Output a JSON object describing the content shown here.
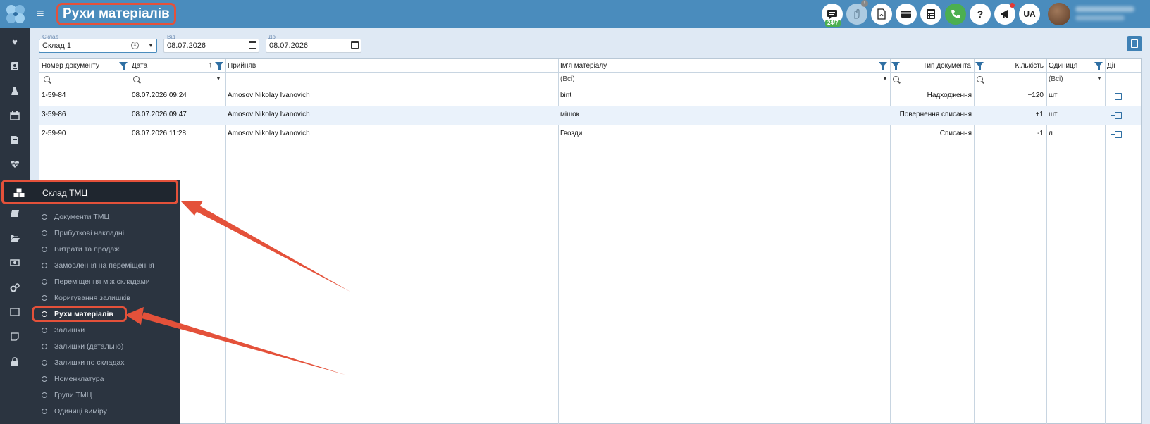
{
  "header": {
    "title": "Рухи матеріалів",
    "support_badge": "24/7",
    "language": "UA",
    "icons": [
      "chat-icon",
      "hand-icon",
      "pdf-icon",
      "card-icon",
      "calculator-icon",
      "phone-icon",
      "help-icon",
      "megaphone-icon"
    ]
  },
  "filters": {
    "warehouse": {
      "label": "Склад",
      "value": "Склад 1"
    },
    "from": {
      "label": "Від",
      "value": "08.07.2026"
    },
    "to": {
      "label": "До",
      "value": "08.07.2026"
    }
  },
  "grid": {
    "columns": [
      "Номер документу",
      "Дата",
      "Прийняв",
      "Ім'я матеріалу",
      "Тип документа",
      "Кількість",
      "Одиниця",
      "Дії"
    ],
    "filter_all": "(Всі)",
    "rows": [
      {
        "doc": "1-59-84",
        "date": "08.07.2026 09:24",
        "accepted": "Amosov Nikolay Ivanovich",
        "material": "bint",
        "type": "Надходження",
        "qty": "+120",
        "unit": "шт"
      },
      {
        "doc": "3-59-86",
        "date": "08.07.2026 09:47",
        "accepted": "Amosov Nikolay Ivanovich",
        "material": "мішок",
        "type": "Повернення списання",
        "qty": "+1",
        "unit": "шт"
      },
      {
        "doc": "2-59-90",
        "date": "08.07.2026 11:28",
        "accepted": "Amosov Nikolay Ivanovich",
        "material": "Гвозди",
        "type": "Списання",
        "qty": "-1",
        "unit": "л"
      }
    ]
  },
  "menu": {
    "section": "Склад ТМЦ",
    "items": [
      "Документи ТМЦ",
      "Прибуткові накладні",
      "Витрати та продажі",
      "Замовлення на переміщення",
      "Переміщення між складами",
      "Коригування залишків",
      "Рухи матеріалів",
      "Залишки",
      "Залишки (детально)",
      "Залишки по складах",
      "Номенклатура",
      "Групи ТМЦ",
      "Одиниці виміру"
    ],
    "active_item": "Рухи матеріалів"
  },
  "colors": {
    "topbar": "#4a8cbd",
    "sidebar": "#2b3440",
    "highlight": "#e4513a",
    "content_bg": "#dfe9f4"
  }
}
